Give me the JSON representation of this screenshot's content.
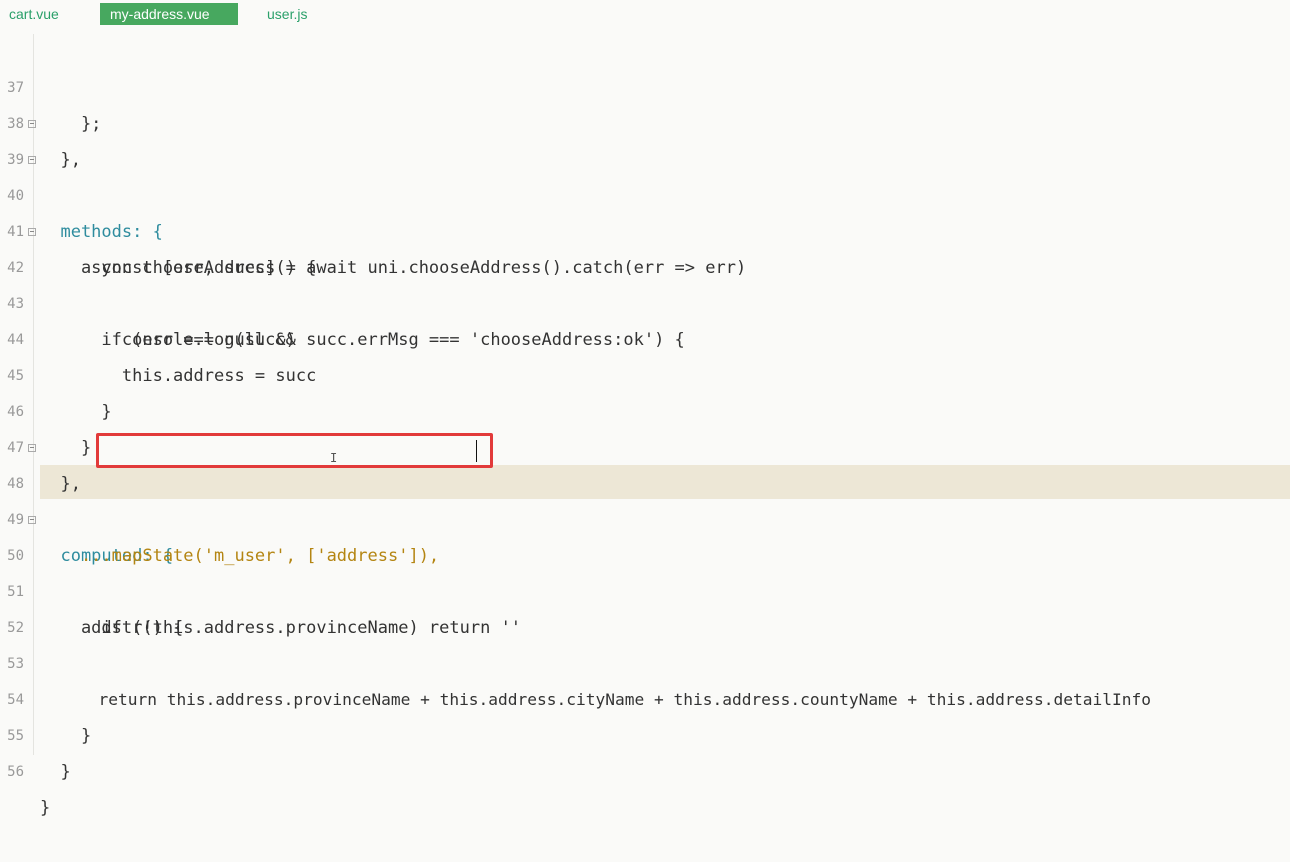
{
  "tabs": [
    {
      "label": "cart.vue",
      "active": false
    },
    {
      "label": "my-address.vue",
      "active": true
    },
    {
      "label": "user.js",
      "active": false
    }
  ],
  "editor": {
    "current_line": 49,
    "highlight_color": "#e23a3a",
    "lines": [
      {
        "n": "37",
        "text": "    };"
      },
      {
        "n": "38",
        "text": "  },"
      },
      {
        "n": "39",
        "text": "  methods: {"
      },
      {
        "n": "40",
        "text": "    async chooseAddress() {"
      },
      {
        "n": "41",
        "text": "      const [err, succ] = await uni.chooseAddress().catch(err => err)"
      },
      {
        "n": "42",
        "text": "      if (err === null && succ.errMsg === 'chooseAddress:ok') {"
      },
      {
        "n": "43",
        "text": "        console.log(succ)"
      },
      {
        "n": "44",
        "text": "        this.address = succ"
      },
      {
        "n": "45",
        "text": "      }"
      },
      {
        "n": "46",
        "text": "    }"
      },
      {
        "n": "47",
        "text": "  },"
      },
      {
        "n": "48",
        "text": "  computed: {"
      },
      {
        "n": "49",
        "text": "    ...mapState('m_user', ['address']),"
      },
      {
        "n": "50",
        "text": "    addstr() {"
      },
      {
        "n": "51",
        "text": "      if (!this.address.provinceName) return ''"
      },
      {
        "n": "52",
        "text": ""
      },
      {
        "n": "53",
        "text": "      return this.address.provinceName + this.address.cityName + this.address.countyName + this.address.detailInfo"
      },
      {
        "n": "54",
        "text": "    }"
      },
      {
        "n": "55",
        "text": "  }"
      },
      {
        "n": "56",
        "text": "}"
      }
    ]
  }
}
